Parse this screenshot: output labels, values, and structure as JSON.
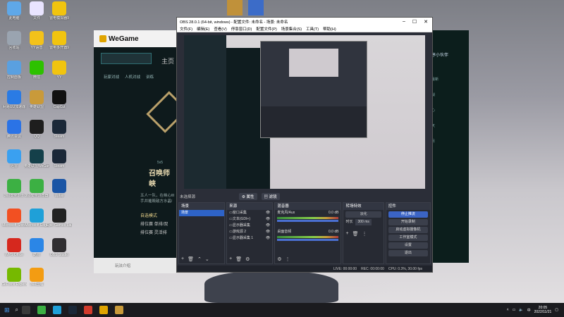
{
  "desktop": {
    "icons": [
      {
        "label": "此电脑",
        "color": "#5fa8e8",
        "col": 0,
        "row": 0
      },
      {
        "label": "文件",
        "color": "#e9e4ff",
        "col": 1,
        "row": 0
      },
      {
        "label": "雷电模拟器9",
        "color": "#f1c40f",
        "col": 2,
        "row": 0
      },
      {
        "label": "回收站",
        "color": "#9aa4b0",
        "col": 0,
        "row": 1
      },
      {
        "label": "YY语音",
        "color": "#f3c21a",
        "col": 1,
        "row": 1
      },
      {
        "label": "雷电多开器9",
        "color": "#f1c40f",
        "col": 2,
        "row": 1
      },
      {
        "label": "控制面板",
        "color": "#5aa0e0",
        "col": 0,
        "row": 2
      },
      {
        "label": "微信",
        "color": "#2dc100",
        "col": 1,
        "row": 2
      },
      {
        "label": "YY",
        "color": "#f1c40f",
        "col": 2,
        "row": 2
      },
      {
        "label": "网易UU加速器",
        "color": "#2a7be4",
        "col": 0,
        "row": 3
      },
      {
        "label": "英雄联盟",
        "color": "#c99a3a",
        "col": 1,
        "row": 3
      },
      {
        "label": "CapCut",
        "color": "#111111",
        "col": 2,
        "row": 3
      },
      {
        "label": "腾讯会议",
        "color": "#2b73e6",
        "col": 0,
        "row": 4
      },
      {
        "label": "QQ",
        "color": "#1e1e1e",
        "col": 1,
        "row": 4
      },
      {
        "label": "Steam",
        "color": "#1b2838",
        "col": 2,
        "row": 4
      },
      {
        "label": "迅雷",
        "color": "#3aa0f0",
        "col": 0,
        "row": 5
      },
      {
        "label": "英雄联盟WeGame",
        "color": "#14404a",
        "col": 1,
        "row": 5
      },
      {
        "label": "Steam",
        "color": "#1b2838",
        "col": 2,
        "row": 5
      },
      {
        "label": "360安全卫士",
        "color": "#3cb043",
        "col": 0,
        "row": 6
      },
      {
        "label": "360安全浏览器",
        "color": "#3cb043",
        "col": 1,
        "row": 6
      },
      {
        "label": "Uplay",
        "color": "#1a55a5",
        "col": 2,
        "row": 6
      },
      {
        "label": "Microsoft Store",
        "color": "#f25022",
        "col": 0,
        "row": 7
      },
      {
        "label": "Microsoft Edge",
        "color": "#1fa0d8",
        "col": 1,
        "row": 7
      },
      {
        "label": "Epic Games Launcher",
        "color": "#222222",
        "col": 2,
        "row": 7
      },
      {
        "label": "WPS Office",
        "color": "#d6281e",
        "col": 0,
        "row": 8
      },
      {
        "label": "酷狗",
        "color": "#2b86e6",
        "col": 1,
        "row": 8
      },
      {
        "label": "OBS Studio",
        "color": "#302e31",
        "col": 2,
        "row": 8
      },
      {
        "label": "GeForce Experience",
        "color": "#76b900",
        "col": 0,
        "row": 9
      },
      {
        "label": "360压缩",
        "color": "#f39c12",
        "col": 1,
        "row": 9
      }
    ]
  },
  "wegame": {
    "logo": "WeGame",
    "nav_home": "主页",
    "tabs": [
      "玩家对战",
      "人机对战",
      "训练"
    ],
    "mode_sub": "5v5",
    "mode_title": "召唤师峡",
    "desc": "五人一队，在峡心ⅡⅠ",
    "desc2": "手并摧毁敌方水晶!",
    "options": [
      "自选模式",
      "排位赛 单排/双",
      "排位赛 灵活排"
    ],
    "bottom_left": "玩法介绍"
  },
  "chat": {
    "title": "序小伙伴",
    "items": [
      "最新",
      "战",
      "心",
      "天",
      "月"
    ]
  },
  "obs": {
    "title": "OBS 28.0.1 (64-bit, windows) - 配置文件: 未命名 - 场景: 未命名",
    "menu": [
      "文件(F)",
      "编辑(E)",
      "查看(V)",
      "停靠窗口(D)",
      "配置文件(P)",
      "场景集合(S)",
      "工具(T)",
      "帮助(H)"
    ],
    "no_source": "未选择源",
    "btn_properties": "属性",
    "btn_filters": "滤镜",
    "scenes": {
      "header": "场景",
      "items": [
        "场景"
      ]
    },
    "sources": {
      "header": "来源",
      "items": [
        "窗口采集",
        "文本(GDI+)",
        "显示器采集",
        "游戏源 2",
        "显示器采集 1"
      ]
    },
    "mixer": {
      "header": "混音器",
      "channels": [
        {
          "name": "麦克风/Aux",
          "db": "0.0 dB"
        },
        {
          "name": "桌面音频",
          "db": "0.0 dB"
        }
      ]
    },
    "transitions": {
      "header": "转场特效",
      "type": "淡化",
      "duration_label": "时长",
      "duration": "300 ms"
    },
    "controls": {
      "header": "控件",
      "buttons": [
        "停止推流",
        "开始录制",
        "启动虚拟摄像机",
        "工作室模式",
        "设置",
        "退出"
      ]
    },
    "status": {
      "live": "LIVE: 00:00:00",
      "rec": "REC: 00:00:00",
      "cpu": "CPU: 0.3%, 30.00 fps"
    }
  },
  "taskbar": {
    "time": "20:05",
    "date": "2022/11/21"
  }
}
